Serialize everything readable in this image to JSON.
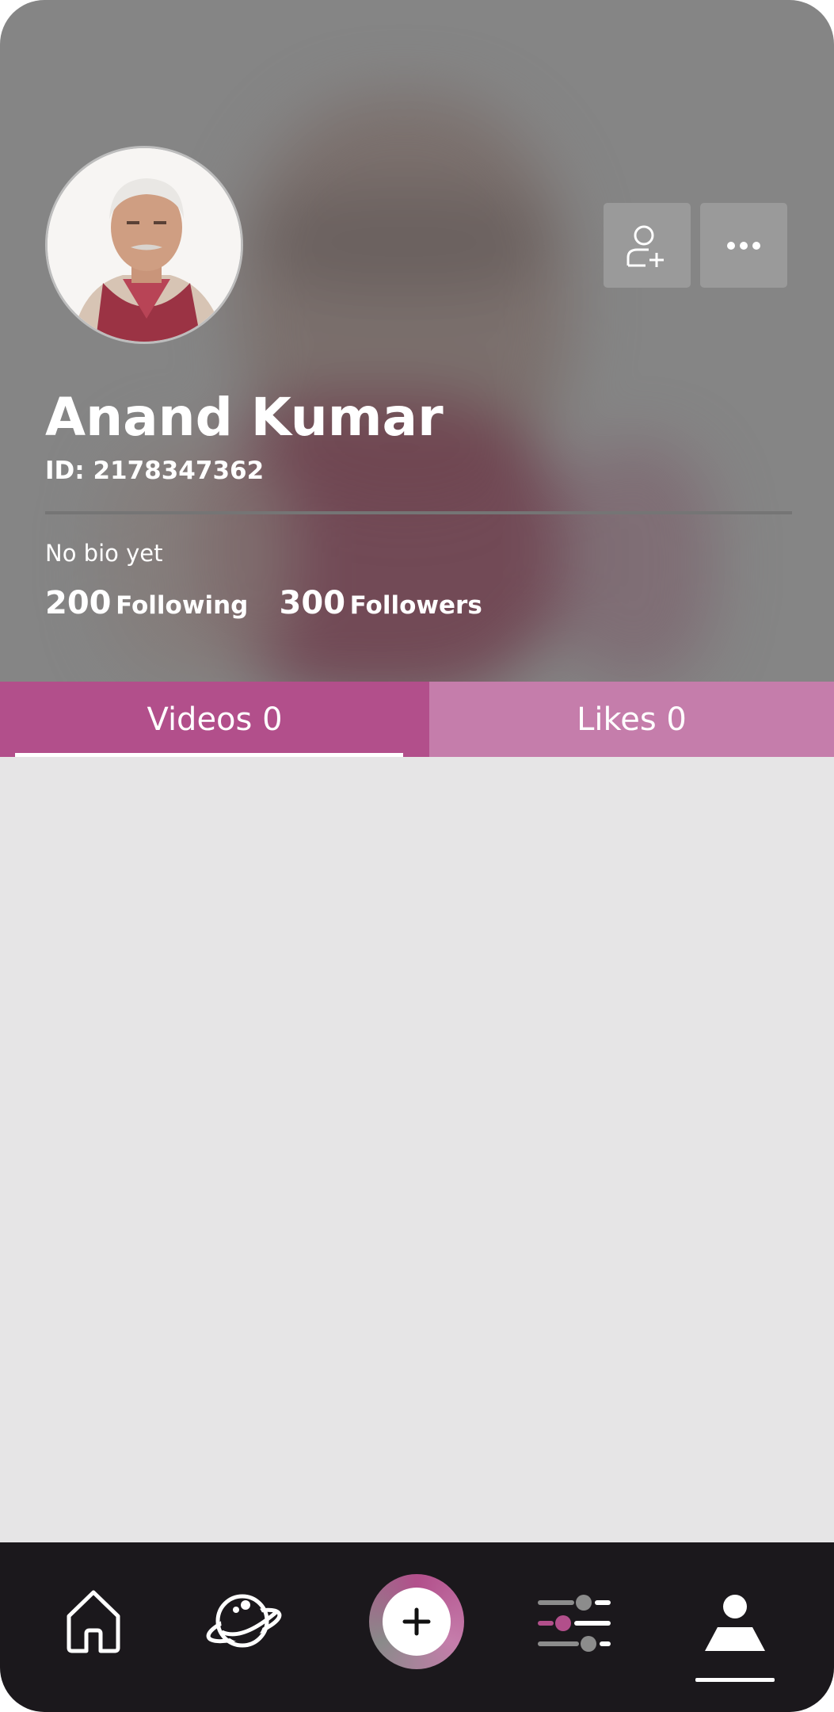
{
  "profile": {
    "name": "Anand Kumar",
    "id_text": "ID: 2178347362",
    "bio": "No bio yet",
    "following_count": "200",
    "following_label": "Following",
    "followers_count": "300",
    "followers_label": "Followers"
  },
  "actions": {
    "follow_icon": "add-user-icon",
    "more_icon": "more-icon"
  },
  "tabs": [
    {
      "label": "Videos 0",
      "active": true
    },
    {
      "label": "Likes 0",
      "active": false
    }
  ],
  "bottom_nav": {
    "items": [
      {
        "icon": "home-icon"
      },
      {
        "icon": "planet-icon"
      },
      {
        "icon": "plus-icon"
      },
      {
        "icon": "sliders-icon"
      },
      {
        "icon": "profile-icon",
        "active": true
      }
    ]
  },
  "colors": {
    "accent": "#b24f8b",
    "accent_light": "#c57dab",
    "header_bg": "#858585",
    "content_bg": "#e6e5e6",
    "nav_bg": "#1b181c"
  }
}
